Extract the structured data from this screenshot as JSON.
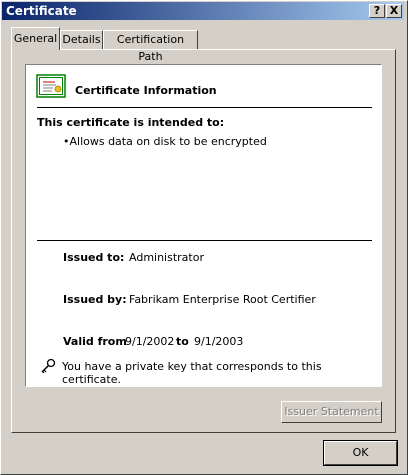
{
  "window": {
    "title": "Certificate"
  },
  "title_buttons": {
    "help": "?",
    "close": "X"
  },
  "tabs": [
    {
      "label": "General",
      "active": true
    },
    {
      "label": "Details",
      "active": false
    },
    {
      "label": "Certification Path",
      "active": false
    }
  ],
  "general": {
    "heading": "Certificate Information",
    "intended_heading": "This certificate is intended to:",
    "purposes": [
      "•Allows data on disk to be encrypted"
    ],
    "issued_to_label": "Issued to:",
    "issued_to": "Administrator",
    "issued_by_label": "Issued by:",
    "issued_by": "Fabrikam Enterprise Root Certifier",
    "valid_from_label": "Valid from",
    "valid_from": "9/1/2002",
    "to_label": "to",
    "valid_to": "9/1/2003",
    "private_key_note": "You have a private key that corresponds to this certificate.",
    "issuer_statement": "Issuer Statement"
  },
  "footer": {
    "ok": "OK"
  },
  "icons": {
    "certificate": "certificate-icon",
    "key": "key-icon"
  }
}
